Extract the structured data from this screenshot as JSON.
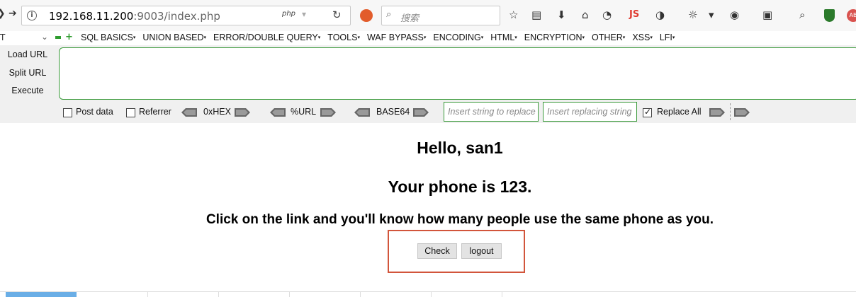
{
  "browser": {
    "url_host": "192.168.11.200",
    "url_rest": ":9003/index.php",
    "php_label": "php",
    "search_placeholder": "搜索",
    "js_label": "JS",
    "abp_label": "AB"
  },
  "hackbar": {
    "selector_value": "T",
    "menu": [
      {
        "label": "SQL BASICS"
      },
      {
        "label": "UNION BASED"
      },
      {
        "label": "ERROR/DOUBLE QUERY"
      },
      {
        "label": "TOOLS"
      },
      {
        "label": "WAF BYPASS"
      },
      {
        "label": "ENCODING"
      },
      {
        "label": "HTML"
      },
      {
        "label": "ENCRYPTION"
      },
      {
        "label": "OTHER"
      },
      {
        "label": "XSS"
      },
      {
        "label": "LFI"
      }
    ],
    "side": {
      "load_url": "Load URL",
      "split_url": "Split URL",
      "execute": "Execute"
    },
    "url_value": "",
    "options": {
      "post_data": "Post data",
      "post_data_checked": false,
      "referrer": "Referrer",
      "referrer_checked": false,
      "hex": "0xHEX",
      "url": "%URL",
      "base64": "BASE64",
      "insert_placeholder": "Insert string to replace",
      "replacing_placeholder": "Insert replacing string",
      "replace_all": "Replace All",
      "replace_all_checked": true
    }
  },
  "page": {
    "greeting": "Hello, san1",
    "phone_line": "Your phone is 123.",
    "instruction": "Click on the link and you'll know how many people use the same phone as you.",
    "check_button": "Check",
    "logout_button": "logout"
  },
  "colors": {
    "hackbar_green": "#3a9a3a",
    "highlight": "#d2553b"
  }
}
